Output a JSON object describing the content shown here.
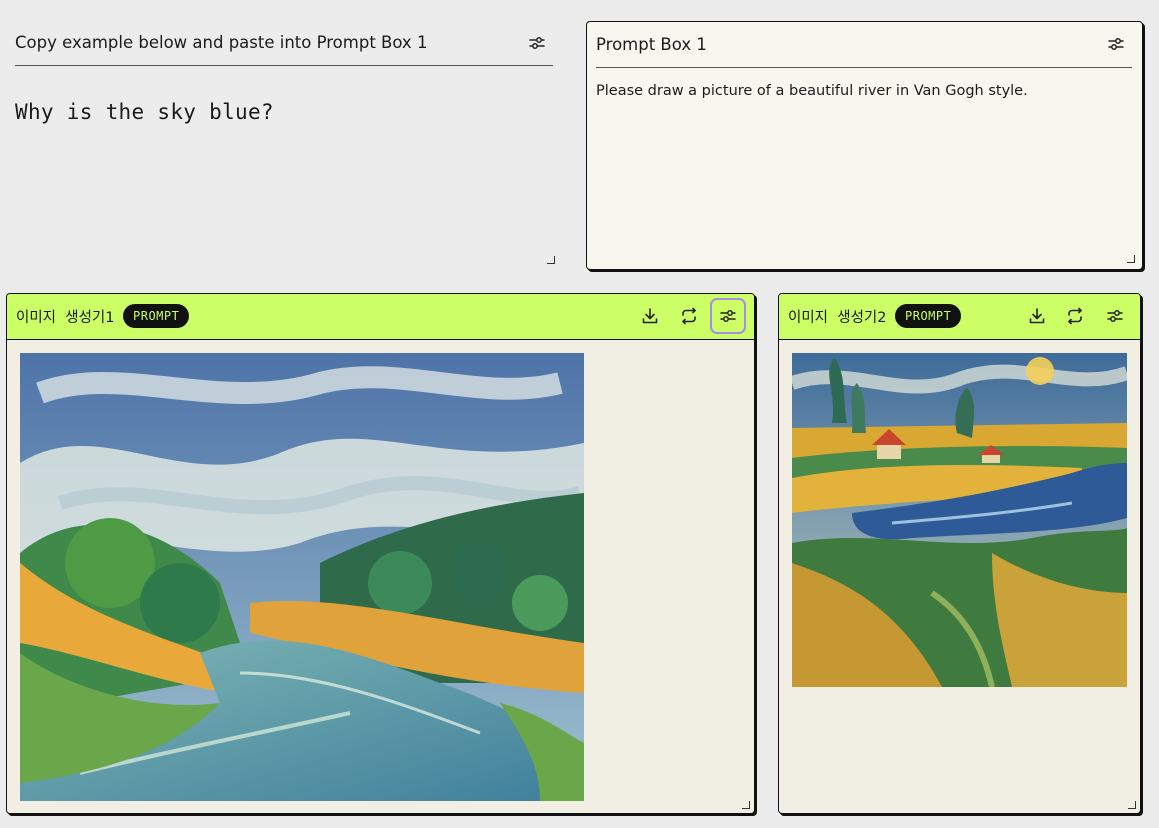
{
  "example": {
    "title": "Copy example below and paste into Prompt Box 1",
    "text": "Why is the sky blue?",
    "settings_icon": "sliders-icon"
  },
  "prompt_box": {
    "title": "Prompt Box 1",
    "text": "Please draw a picture of a beautiful river in Van Gogh style.",
    "settings_icon": "sliders-icon"
  },
  "generators": [
    {
      "name": "이미지  생성기1",
      "badge": "PROMPT",
      "image_description": "Van Gogh style painting of a winding river with swirling clouds and green trees",
      "icons": [
        "download-icon",
        "regenerate-icon",
        "sliders-icon"
      ]
    },
    {
      "name": "이미지  생성기2",
      "badge": "PROMPT",
      "image_description": "Van Gogh style painting of a river through golden fields with a red-roofed farmhouse",
      "icons": [
        "download-icon",
        "regenerate-icon",
        "sliders-icon"
      ]
    }
  ],
  "colors": {
    "accent": "#ccff66",
    "focus_ring": "#a88ee8",
    "panel_bg": "#f1efe3",
    "page_bg": "#ececec"
  }
}
